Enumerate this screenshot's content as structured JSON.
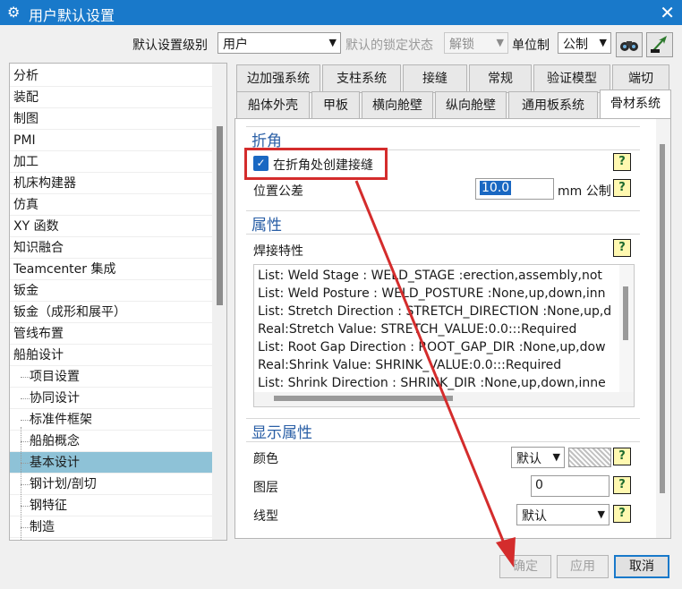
{
  "window": {
    "title": "用户默认设置"
  },
  "toolbar": {
    "level_label": "默认设置级别",
    "level_value": "用户",
    "lock_label": "默认的锁定状态",
    "lock_value": "解锁",
    "unit_label": "单位制",
    "unit_value": "公制"
  },
  "tree": {
    "items": [
      {
        "label": "分析"
      },
      {
        "label": "装配"
      },
      {
        "label": "制图"
      },
      {
        "label": "PMI"
      },
      {
        "label": "加工"
      },
      {
        "label": "机床构建器"
      },
      {
        "label": "仿真"
      },
      {
        "label": "XY 函数"
      },
      {
        "label": "知识融合"
      },
      {
        "label": "Teamcenter 集成"
      },
      {
        "label": "钣金"
      },
      {
        "label": "钣金（成形和展平）"
      },
      {
        "label": "管线布置"
      },
      {
        "label": "船舶设计"
      }
    ],
    "children": [
      {
        "label": "项目设置"
      },
      {
        "label": "协同设计"
      },
      {
        "label": "标准件框架"
      },
      {
        "label": "船舶概念"
      },
      {
        "label": "基本设计"
      },
      {
        "label": "钢计划/剖切"
      },
      {
        "label": "钢特征"
      },
      {
        "label": "制造"
      }
    ],
    "selected": "基本设计"
  },
  "tabs_row1": [
    "边加强系统",
    "支柱系统",
    "接缝",
    "常规",
    "验证模型",
    "端切"
  ],
  "tabs_row2": [
    "船体外壳",
    "甲板",
    "横向舱壁",
    "纵向舱壁",
    "通用板系统",
    "骨材系统"
  ],
  "active_tab": "骨材系统",
  "sections": {
    "bend": {
      "title": "折角",
      "checkbox_label": "在折角处创建接缝",
      "checkbox_checked": true,
      "tolerance_label": "位置公差",
      "tolerance_value": "10.0",
      "tolerance_unit": "mm 公制"
    },
    "attributes": {
      "title": "属性",
      "weld_label": "焊接特性",
      "weld_list": [
        "List: Weld Stage : WELD_STAGE :erection,assembly,not",
        "List: Weld Posture : WELD_POSTURE :None,up,down,inn",
        "List: Stretch Direction : STRETCH_DIRECTION :None,up,d",
        "Real:Stretch Value: STRETCH_VALUE:0.0:::Required",
        "List: Root Gap Direction : ROOT_GAP_DIR :None,up,dow",
        "Real:Shrink Value: SHRINK_VALUE:0.0:::Required",
        "List: Shrink Direction : SHRINK_DIR :None,up,down,inne"
      ]
    },
    "display": {
      "title": "显示属性",
      "color_label": "颜色",
      "color_value": "默认",
      "layer_label": "图层",
      "layer_value": "0",
      "linetype_label": "线型",
      "linetype_value": "默认"
    }
  },
  "buttons": {
    "ok": "确定",
    "apply": "应用",
    "cancel": "取消"
  },
  "colors": {
    "titlebar": "#1979ca",
    "highlight": "#d42c2c",
    "section": "#2a5fa6"
  }
}
